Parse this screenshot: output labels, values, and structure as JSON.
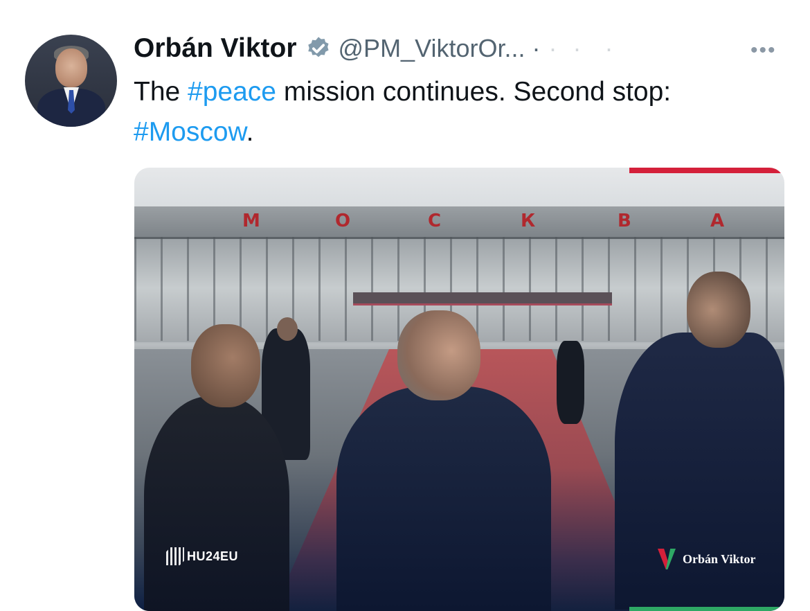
{
  "author": {
    "name": "Orbán Viktor",
    "handle": "@PM_ViktorOr...",
    "separator": "·",
    "faded_time": "·  ·   ·"
  },
  "menu": {
    "more_label": "•••"
  },
  "tweet": {
    "text_part1": "The ",
    "hashtag1": "#peace",
    "text_part2": " mission continues. Second stop:",
    "hashtag2": "#Moscow",
    "text_part3": "."
  },
  "media": {
    "sign_letters": [
      "М",
      "О",
      "С",
      "К",
      "В",
      "А"
    ],
    "watermark_left": "HU24EU",
    "watermark_right": "Orbán Viktor"
  },
  "colors": {
    "hashtag": "#1d9bf0",
    "handle": "#536471",
    "verified": "#829aab",
    "accent_red": "#d4203a",
    "accent_green": "#2ea865"
  },
  "icons": {
    "verified": "verified-badge-icon",
    "more": "more-options-icon"
  }
}
